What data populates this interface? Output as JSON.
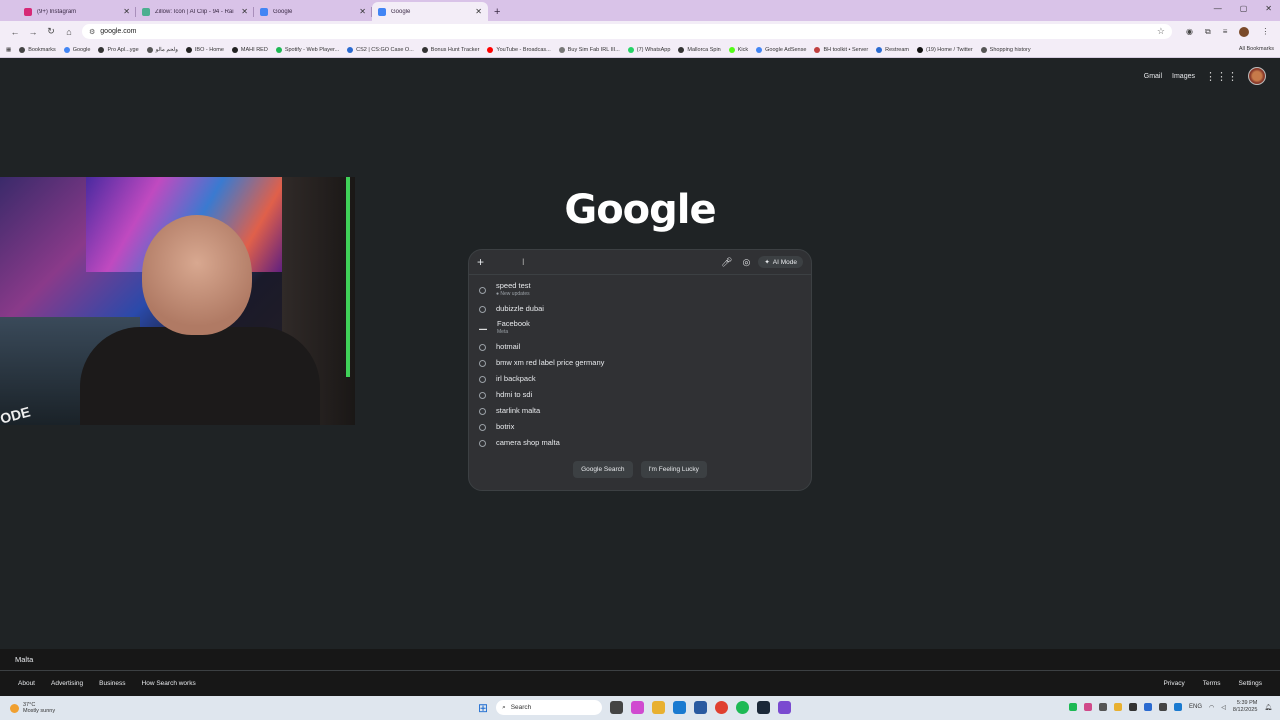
{
  "browser": {
    "tabs": [
      {
        "title": "(9+) Instagram",
        "color": "#d62976",
        "active": false
      },
      {
        "title": "Zillow: Icon | AI Clip - 94 - Rai",
        "color": "#4caf90",
        "active": false
      },
      {
        "title": "Google",
        "color": "#4285f4",
        "active": false
      },
      {
        "title": "Google",
        "color": "#4285f4",
        "active": true
      }
    ],
    "new_tab": "+",
    "address": "google.com",
    "bookmarks": [
      {
        "label": "Bookmarks",
        "color": "#444"
      },
      {
        "label": "Google",
        "color": "#4285f4"
      },
      {
        "label": "Pro Apl...yge",
        "color": "#333"
      },
      {
        "label": "ولحم مالو",
        "color": "#555"
      },
      {
        "label": "IBO - Home",
        "color": "#222"
      },
      {
        "label": "MAHI RED",
        "color": "#222"
      },
      {
        "label": "Spotify - Web Player...",
        "color": "#1db954"
      },
      {
        "label": "CS2 | CS:GO Case O...",
        "color": "#2a6ad0"
      },
      {
        "label": "Bonus Hunt Tracker",
        "color": "#333"
      },
      {
        "label": "YouTube - Broadcas...",
        "color": "#ff0000"
      },
      {
        "label": "Buy Sim Fab IRL III...",
        "color": "#777"
      },
      {
        "label": "(7) WhatsApp",
        "color": "#25d366"
      },
      {
        "label": "Mallorca Spin",
        "color": "#333"
      },
      {
        "label": "Kick",
        "color": "#53fc18"
      },
      {
        "label": "Google AdSense",
        "color": "#4285f4"
      },
      {
        "label": "BH toolkit • Server",
        "color": "#c04040"
      },
      {
        "label": "Restream",
        "color": "#2a6ad0"
      },
      {
        "label": "(19) Home / Twitter",
        "color": "#111"
      },
      {
        "label": "Shopping history",
        "color": "#555"
      }
    ],
    "all_bookmarks": "All Bookmarks"
  },
  "page": {
    "gmail": "Gmail",
    "images": "Images",
    "logo": "Google",
    "search": {
      "ai_mode": "AI Mode",
      "suggestions": [
        {
          "text": "speed test",
          "sub": "● New updates",
          "type": "history"
        },
        {
          "text": "dubizzle dubai",
          "sub": "",
          "type": "history"
        },
        {
          "text": "Facebook",
          "sub": "Meta",
          "type": "entity"
        },
        {
          "text": "hotmail",
          "sub": "",
          "type": "history"
        },
        {
          "text": "bmw xm red label price germany",
          "sub": "",
          "type": "history"
        },
        {
          "text": "irl backpack",
          "sub": "",
          "type": "history"
        },
        {
          "text": "hdmi to sdi",
          "sub": "",
          "type": "history"
        },
        {
          "text": "starlink malta",
          "sub": "",
          "type": "history"
        },
        {
          "text": "botrix",
          "sub": "",
          "type": "history"
        },
        {
          "text": "camera shop malta",
          "sub": "",
          "type": "history"
        }
      ],
      "google_search": "Google Search",
      "feeling_lucky": "I'm Feeling Lucky"
    },
    "footer": {
      "location": "Malta",
      "left_links": [
        "About",
        "Advertising",
        "Business",
        "How Search works"
      ],
      "right_links": [
        "Privacy",
        "Terms",
        "Settings"
      ]
    }
  },
  "webcam": {
    "overlay_text": "ODE"
  },
  "taskbar": {
    "weather_temp": "37°C",
    "weather_desc": "Mostly sunny",
    "search": "Search",
    "lang": "ENG",
    "time": "5:39 PM",
    "date": "8/12/2025"
  }
}
